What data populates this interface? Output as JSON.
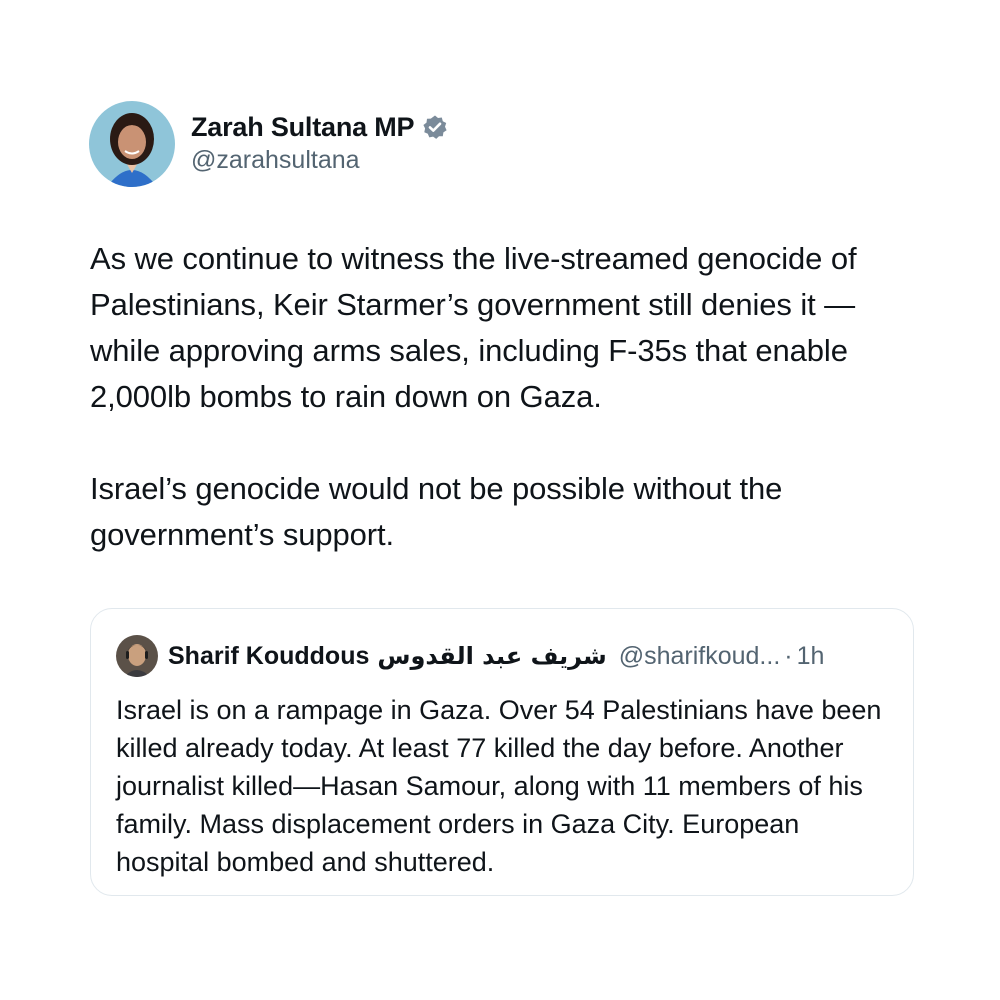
{
  "tweet": {
    "author": {
      "name": "Zarah Sultana MP",
      "handle": "@zarahsultana",
      "verified_icon": "verified-badge-icon",
      "verified_color": "#7b8b9a"
    },
    "paragraphs": [
      "As we continue to witness the live-streamed genocide of Palestinians, Keir Starmer’s government still denies it — while approving arms sales, including F-35s that enable 2,000lb bombs to rain down on Gaza.",
      "Israel’s genocide would not be possible without the government’s support."
    ]
  },
  "quoted_tweet": {
    "author": {
      "name": "Sharif Kouddous",
      "name_arabic": "شريف عبد القدوس",
      "handle": "@sharifkoud...",
      "separator": "·",
      "time": "1h"
    },
    "text": "Israel is on a rampage in Gaza. Over 54 Palestinians have been killed already today. At least 77 killed the day before. Another journalist killed—Hasan Samour, along with 11 members of his family. Mass displacement orders in Gaza City. European hospital bombed and shuttered."
  },
  "colors": {
    "text_primary": "#0f1419",
    "text_secondary": "#536471",
    "quote_border": "#e1e8ed",
    "background": "#ffffff"
  }
}
